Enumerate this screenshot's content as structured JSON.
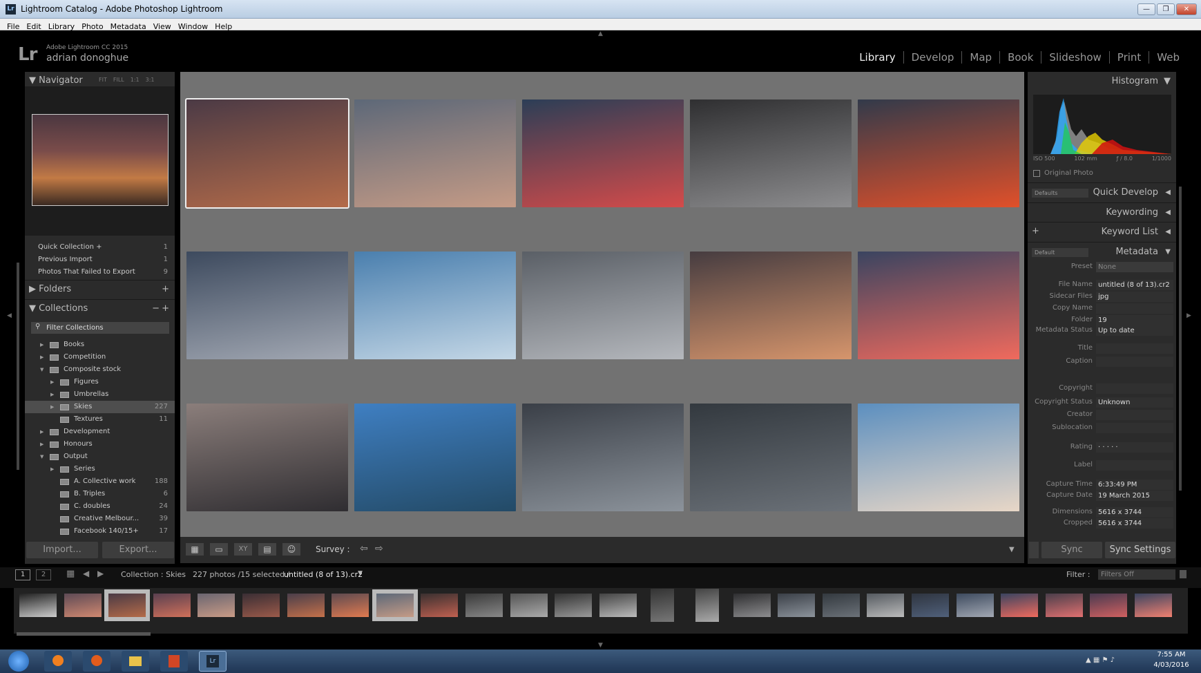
{
  "window": {
    "title": "Lightroom Catalog - Adobe Photoshop Lightroom",
    "icon": "Lr",
    "min": "—",
    "max": "❐",
    "close": "✕"
  },
  "menu": [
    "File",
    "Edit",
    "Library",
    "Photo",
    "Metadata",
    "View",
    "Window",
    "Help"
  ],
  "identity": {
    "logo": "Lr",
    "version": "Adobe Lightroom CC 2015",
    "user": "adrian donoghue"
  },
  "modules": [
    "Library",
    "Develop",
    "Map",
    "Book",
    "Slideshow",
    "Print",
    "Web"
  ],
  "navigator": {
    "title": "Navigator",
    "zoom": [
      "FIT",
      "FILL",
      "1:1",
      "3:1"
    ]
  },
  "catalog": [
    {
      "label": "Quick Collection +",
      "count": "1"
    },
    {
      "label": "Previous Import",
      "count": "1"
    },
    {
      "label": "Photos That Failed to Export",
      "count": "9"
    }
  ],
  "folders": {
    "title": "Folders"
  },
  "collections": {
    "title": "Collections",
    "filter": "Filter Collections",
    "items": [
      {
        "label": "Books",
        "count": "",
        "indent": 1,
        "arrow": "▶"
      },
      {
        "label": "Competition",
        "count": "",
        "indent": 1,
        "arrow": "▶"
      },
      {
        "label": "Composite stock",
        "count": "",
        "indent": 1,
        "arrow": "▼"
      },
      {
        "label": "Figures",
        "count": "",
        "indent": 2,
        "arrow": "▶"
      },
      {
        "label": "Umbrellas",
        "count": "",
        "indent": 2,
        "arrow": "▶"
      },
      {
        "label": "Skies",
        "count": "227",
        "indent": 2,
        "arrow": "▶",
        "selected": true
      },
      {
        "label": "Textures",
        "count": "11",
        "indent": 2,
        "arrow": ""
      },
      {
        "label": "Development",
        "count": "",
        "indent": 1,
        "arrow": "▶"
      },
      {
        "label": "Honours",
        "count": "",
        "indent": 1,
        "arrow": "▶"
      },
      {
        "label": "Output",
        "count": "",
        "indent": 1,
        "arrow": "▼"
      },
      {
        "label": "Series",
        "count": "",
        "indent": 2,
        "arrow": "▶"
      },
      {
        "label": "A. Collective work",
        "count": "188",
        "indent": 2,
        "arrow": ""
      },
      {
        "label": "B. Triples",
        "count": "6",
        "indent": 2,
        "arrow": ""
      },
      {
        "label": "C. doubles",
        "count": "24",
        "indent": 2,
        "arrow": ""
      },
      {
        "label": "Creative Melbour...",
        "count": "39",
        "indent": 2,
        "arrow": ""
      },
      {
        "label": "Facebook 140/15+",
        "count": "17",
        "indent": 2,
        "arrow": ""
      }
    ]
  },
  "buttons": {
    "import": "Import...",
    "export": "Export...",
    "sync": "Sync",
    "sync_settings": "Sync Settings"
  },
  "toolbar": {
    "survey": "Survey :"
  },
  "grid": [
    {
      "c1": "#4b3a45",
      "c2": "#b46b49",
      "sel": true
    },
    {
      "c1": "#5d6878",
      "c2": "#c59b86"
    },
    {
      "c1": "#2c3e56",
      "c2": "#d44b4a"
    },
    {
      "c1": "#2f2f31",
      "c2": "#8d8d8f"
    },
    {
      "c1": "#323a4a",
      "c2": "#e0502a"
    },
    {
      "c1": "#3d4a5e",
      "c2": "#a2a8b3"
    },
    {
      "c1": "#4a7fae",
      "c2": "#c4d7e6"
    },
    {
      "c1": "#5a5f66",
      "c2": "#b5b8bd"
    },
    {
      "c1": "#463c40",
      "c2": "#d6956c"
    },
    {
      "c1": "#3a4460",
      "c2": "#f06a5d"
    },
    {
      "c1": "#8b7e7b",
      "c2": "#2f2d31"
    },
    {
      "c1": "#3f7fc2",
      "c2": "#234a66"
    },
    {
      "c1": "#3a3f47",
      "c2": "#8c939b"
    },
    {
      "c1": "#33393f",
      "c2": "#6b7178"
    },
    {
      "c1": "#5c8fbf",
      "c2": "#e8d7c7"
    }
  ],
  "filmstrip": {
    "collection": "Collection : Skies",
    "count": "227 photos /15 selected /",
    "file": "untitled (8 of 13).cr2",
    "filter_label": "Filter :",
    "filter_value": "Filters Off",
    "tabs": [
      "1",
      "2"
    ]
  },
  "histogram": {
    "title": "Histogram",
    "iso": "ISO 500",
    "focal": "102 mm",
    "aperture": "ƒ / 8.0",
    "shutter": "1/1000",
    "original": "Original Photo"
  },
  "quick_develop": {
    "title": "Quick Develop",
    "preset": "Defaults"
  },
  "keywording": {
    "title": "Keywording"
  },
  "keyword_list": {
    "title": "Keyword List"
  },
  "metadata": {
    "title": "Metadata",
    "preset_select": "Default",
    "fields": [
      {
        "label": "Preset",
        "value": "None"
      },
      {
        "label": "File Name",
        "value": "untitled (8 of 13).cr2"
      },
      {
        "label": "Sidecar Files",
        "value": "jpg"
      },
      {
        "label": "Copy Name",
        "value": ""
      },
      {
        "label": "Folder",
        "value": "19"
      },
      {
        "label": "Metadata Status",
        "value": "Up to date"
      },
      {
        "label": "Title",
        "value": ""
      },
      {
        "label": "Caption",
        "value": ""
      },
      {
        "label": "Copyright",
        "value": ""
      },
      {
        "label": "Copyright Status",
        "value": "Unknown"
      },
      {
        "label": "Creator",
        "value": ""
      },
      {
        "label": "Sublocation",
        "value": ""
      },
      {
        "label": "Rating",
        "value": "· · · · ·"
      },
      {
        "label": "Label",
        "value": ""
      },
      {
        "label": "Capture Time",
        "value": "6:33:49 PM"
      },
      {
        "label": "Capture Date",
        "value": "19 March 2015"
      },
      {
        "label": "Dimensions",
        "value": "5616 x 3744"
      },
      {
        "label": "Cropped",
        "value": "5616 x 3744"
      }
    ]
  },
  "taskbar": {
    "time": "7:55 AM",
    "date": "4/03/2016"
  }
}
